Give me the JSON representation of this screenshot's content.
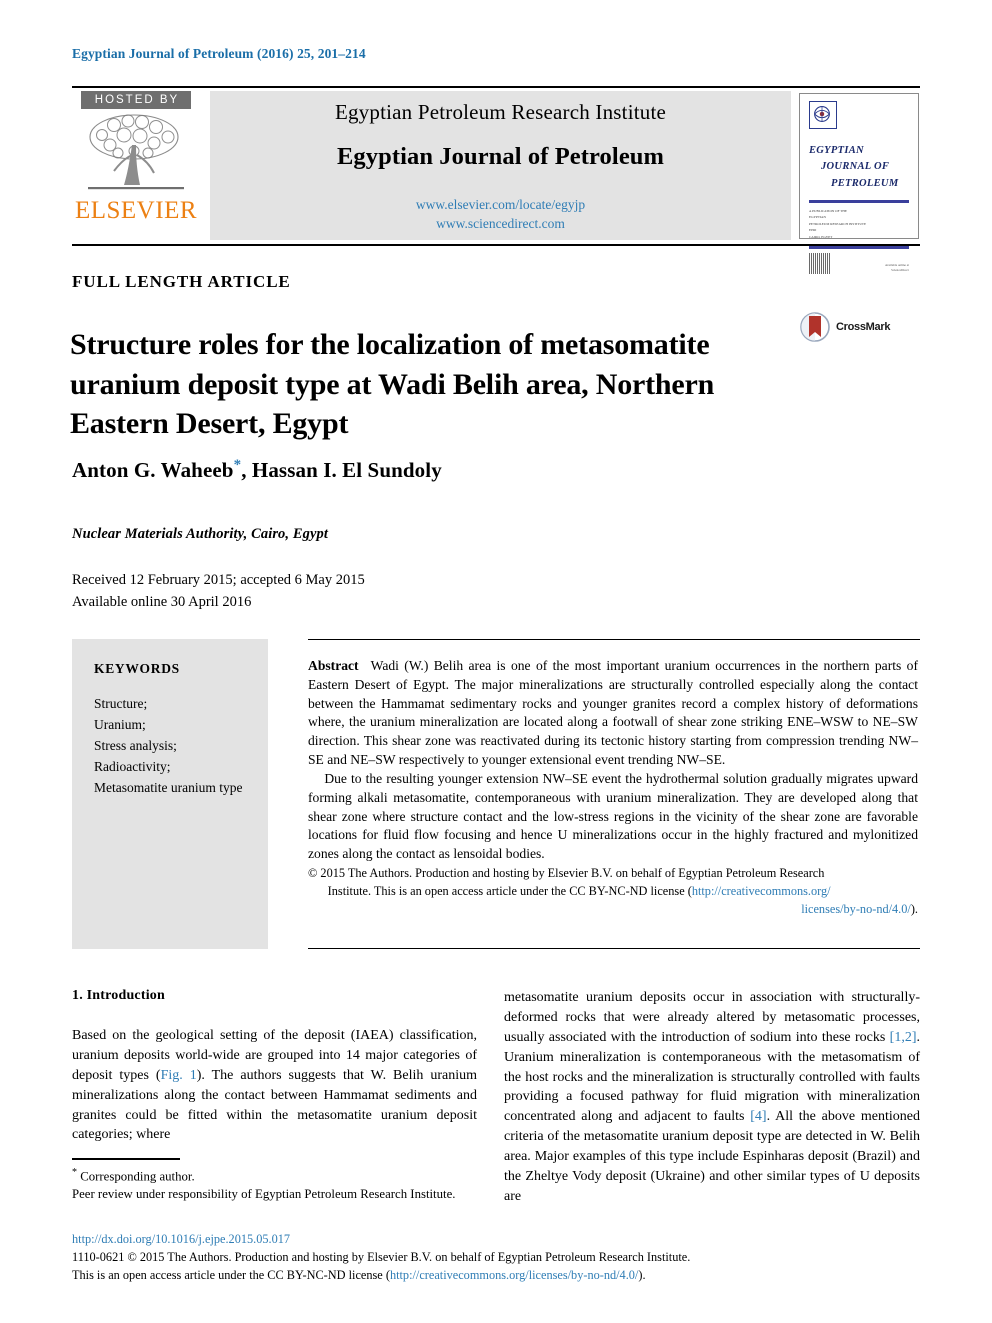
{
  "running_head": "Egyptian Journal of Petroleum (2016) 25, 201–214",
  "masthead": {
    "hosted_by_label": "HOSTED BY",
    "publisher_name": "ELSEVIER",
    "tree_icon": "elsevier-tree-icon",
    "institute_line": "Egyptian Petroleum Research Institute",
    "journal_line": "Egyptian Journal of Petroleum",
    "url_elsevier": "www.elsevier.com/locate/egyjp",
    "url_sciencedirect": "www.sciencedirect.com",
    "cover": {
      "title_line1": "EGYPTIAN",
      "title_line2": "JOURNAL OF",
      "title_line3": "PETROLEUM",
      "meta_line1": "A PUBLICATION OF THE",
      "meta_line2": "EGYPTIAN",
      "meta_line3": "PETROLEUM RESEARCH INSTITUTE",
      "meta_line4": "EPRI",
      "meta_line5": "CAIRO, EGYPT",
      "foot_text1": "Available online at",
      "foot_text2": "ScienceDirect"
    }
  },
  "article": {
    "type_label": "FULL LENGTH ARTICLE",
    "title": "Structure roles for the localization of metasomatite uranium deposit type at Wadi Belih area, Northern Eastern Desert, Egypt",
    "crossmark_label": "CrossMark",
    "authors": "Anton G. Waheeb",
    "authors_rest": ", Hassan I. El Sundoly",
    "corresponding_marker": "*",
    "affiliation": "Nuclear Materials Authority, Cairo, Egypt",
    "received": "Received 12 February 2015; accepted 6 May 2015",
    "available_online": "Available online 30 April 2016"
  },
  "keywords": {
    "heading": "KEYWORDS",
    "items": [
      "Structure;",
      "Uranium;",
      "Stress analysis;",
      "Radioactivity;",
      "Metasomatite uranium type"
    ]
  },
  "abstract": {
    "heading": "Abstract",
    "paragraph1": "Wadi (W.) Belih area is one of the most important uranium occurrences in the northern parts of Eastern Desert of Egypt. The major mineralizations are structurally controlled especially along the contact between the Hammamat sedimentary rocks and younger granites record a complex history of deformations where, the uranium mineralization are located along a footwall of shear zone striking ENE–WSW to NE–SW direction. This shear zone was reactivated during its tectonic history starting from compression trending NW–SE and NE–SW respectively to younger extensional event trending NW–SE.",
    "paragraph2": "Due to the resulting younger extension NW–SE event the hydrothermal solution gradually migrates upward forming alkali metasomatite, contemporaneous with uranium mineralization. They are developed along that shear zone where structure contact and the low-stress regions in the vicinity of the shear zone are favorable locations for fluid flow focusing and hence U mineralizations occur in the highly fractured and mylonitized zones along the contact as lensoidal bodies.",
    "copyright_part1": "© 2015 The Authors. Production and hosting by Elsevier B.V. on behalf of Egyptian Petroleum Research",
    "copyright_part2": "Institute.  This is an open access article under the CC BY-NC-ND license (",
    "license_url_line1": "http://creativecommons.org/",
    "license_url_line2": "licenses/by-no-nd/4.0/",
    "copyright_part3": ")."
  },
  "introduction": {
    "heading": "1. Introduction",
    "left_text_a": "Based on the geological setting of the deposit (IAEA) classification, uranium deposits world-wide are grouped into 14 major categories of deposit types (",
    "left_fig_ref": "Fig. 1",
    "left_text_b": "). The authors suggests that W. Belih uranium mineralizations along the contact between Hammamat sediments and granites could be fitted within the metasomatite uranium deposit categories; where",
    "right_text_a": "metasomatite uranium deposits occur in association with structurally-deformed rocks that were already altered by metasomatic processes, usually associated with the introduction of sodium into these rocks ",
    "right_ref1": "[1,2]",
    "right_text_b": ". Uranium mineralization is contemporaneous with the metasomatism of the host rocks and the mineralization is structurally controlled with faults providing a focused pathway for fluid migration with mineralization concentrated along and adjacent to faults ",
    "right_ref2": "[4]",
    "right_text_c": ". All the above mentioned criteria of the metasomatite uranium deposit type are detected in W. Belih area. Major examples of this type include Espinharas deposit (Brazil) and the Zheltye Vody deposit (Ukraine) and other similar types of U deposits are"
  },
  "footnote": {
    "corresponding": "Corresponding author.",
    "peer_review": "Peer review under responsibility of Egyptian Petroleum Research Institute."
  },
  "page_footer": {
    "doi": "http://dx.doi.org/10.1016/j.ejpe.2015.05.017",
    "line1": "1110-0621 © 2015 The Authors. Production and hosting by Elsevier B.V. on behalf of Egyptian Petroleum Research Institute.",
    "line2_pre": "This is an open access article under the CC BY-NC-ND license (",
    "line2_link": "http://creativecommons.org/licenses/by-no-nd/4.0/",
    "line2_post": ")."
  },
  "colors": {
    "link_blue": "#2f7db5",
    "running_head_blue": "#1a6ea8",
    "elsevier_orange": "#ec8013",
    "hosted_by_grey": "#6f6f6f",
    "panel_grey": "#e3e3e3",
    "cover_navy": "#1b2a6b",
    "crossmark_red": "#b1332b"
  }
}
